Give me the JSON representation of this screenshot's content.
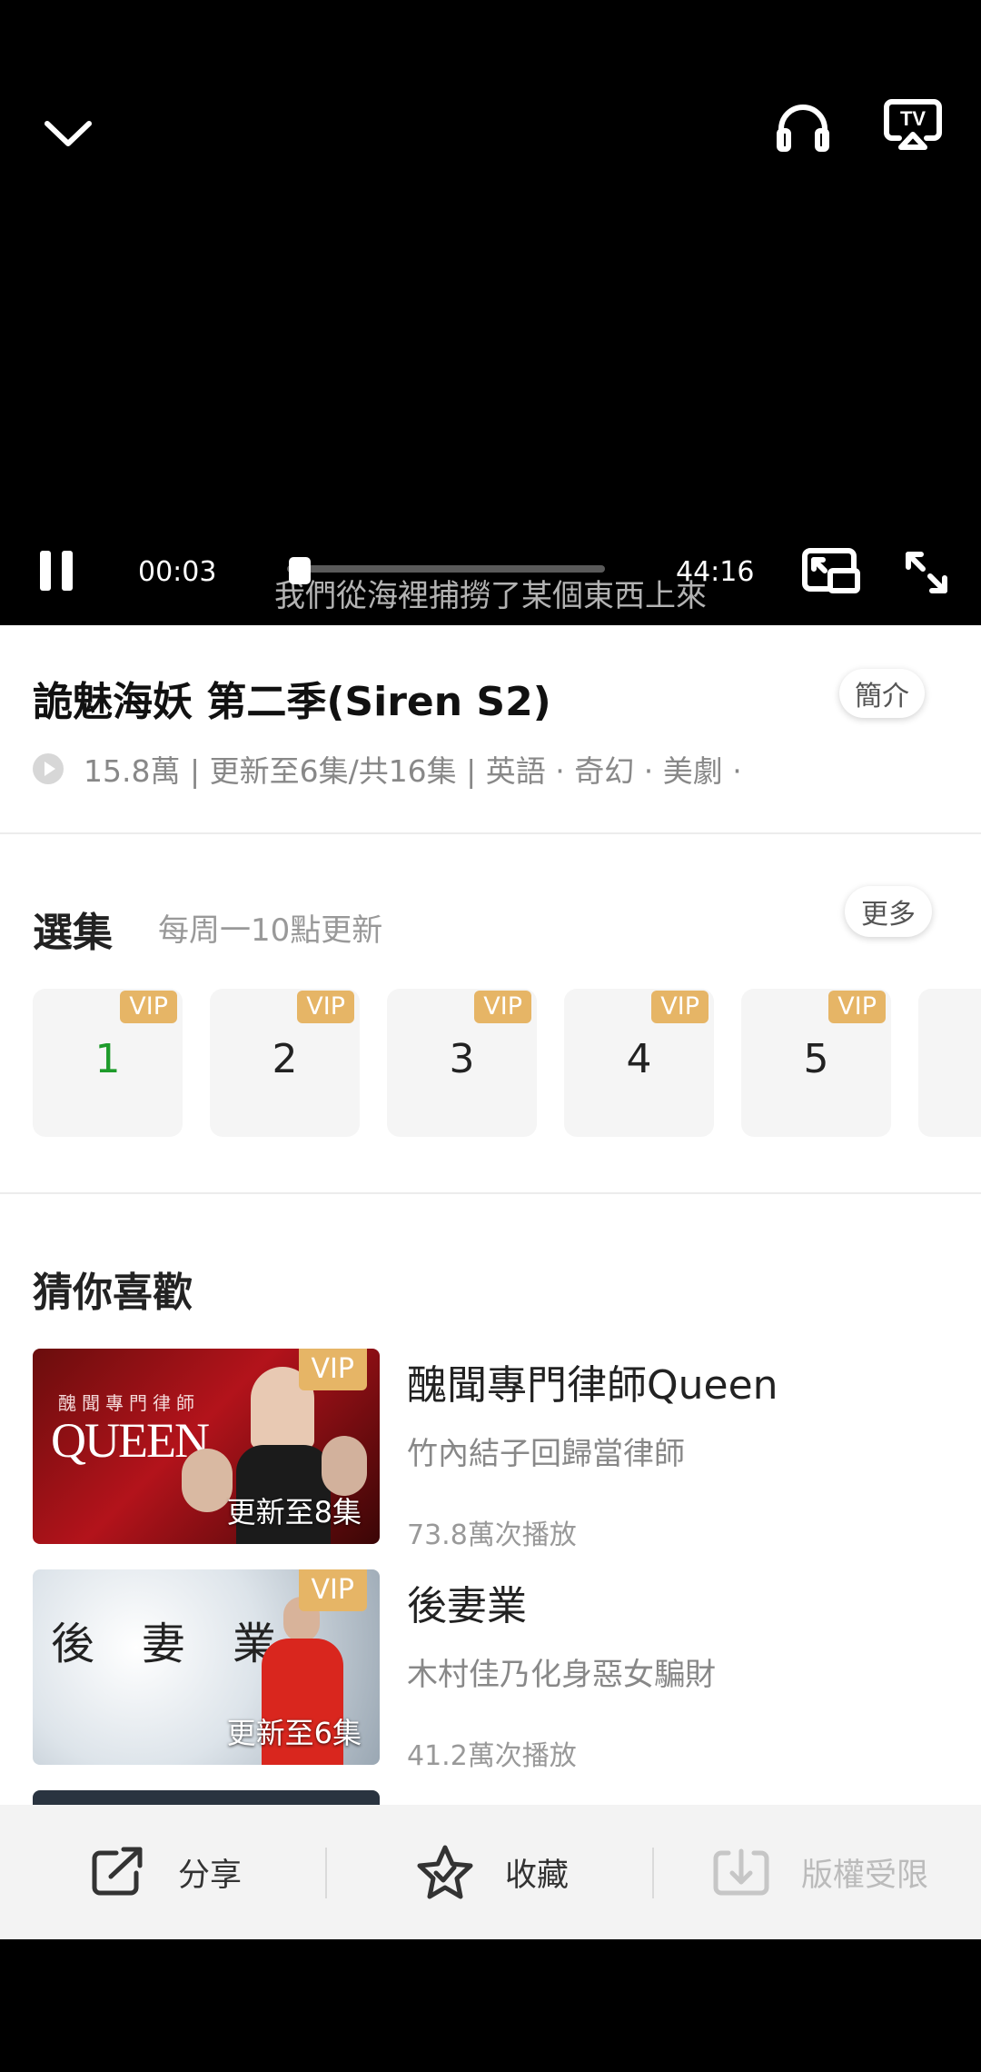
{
  "player": {
    "current_time": "00:03",
    "duration": "44:16",
    "progress": 0.001,
    "subtitle": "我們從海裡捕撈了某個東西上來"
  },
  "show": {
    "title": "詭魅海妖 第二季(Siren S2)",
    "intro_label": "簡介",
    "meta": "15.8萬 | 更新至6集/共16集 | 英語 · 奇幻 · 美劇 ·"
  },
  "episodes": {
    "title": "選集",
    "schedule": "每周一10點更新",
    "more_label": "更多",
    "badge": "VIP",
    "items": [
      "1",
      "2",
      "3",
      "4",
      "5"
    ],
    "current_color": "#1e9b2b"
  },
  "recommend": {
    "title": "猜你喜歡",
    "items": [
      {
        "thumb_text": "QUEEN",
        "thumb_caption": "醜聞專門律師",
        "badge": "VIP",
        "update": "更新至8集",
        "name": "醜聞專門律師Queen",
        "desc": "竹內結子回歸當律師",
        "plays": "73.8萬次播放"
      },
      {
        "thumb_text": "後 妻 業",
        "badge": "VIP",
        "update": "更新至6集",
        "name": "後妻業",
        "desc": "木村佳乃化身惡女騙財",
        "plays": "41.2萬次播放"
      }
    ]
  },
  "actions": {
    "share": "分享",
    "favorite": "收藏",
    "download": "版權受限"
  },
  "colors": {
    "vip_badge": "#e6b566",
    "accent_green": "#1e9b2b"
  }
}
